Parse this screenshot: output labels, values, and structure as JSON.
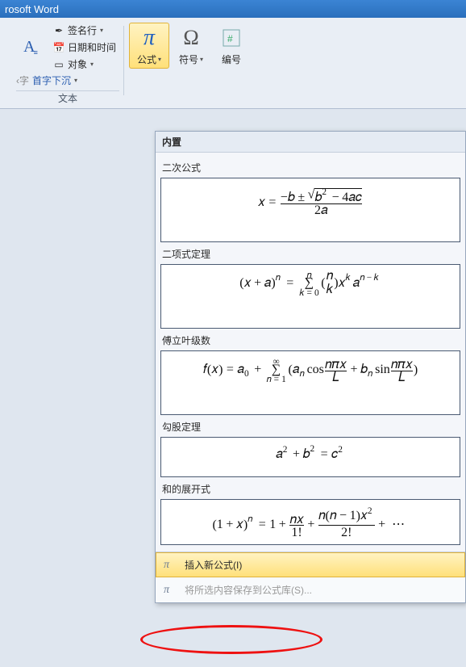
{
  "titlebar": {
    "title": "rosoft Word"
  },
  "ribbon": {
    "group_text": {
      "dropcap_label": "首字下沉",
      "signature_label": "签名行",
      "datetime_label": "日期和时间",
      "object_label": "对象",
      "label": "文本"
    },
    "group_symbols": {
      "equation_label": "公式",
      "symbol_label": "符号",
      "number_label": "编号"
    }
  },
  "gallery": {
    "header": "内置",
    "items": [
      {
        "title": "二次公式"
      },
      {
        "title": "二项式定理"
      },
      {
        "title": "傅立叶级数"
      },
      {
        "title": "勾股定理"
      },
      {
        "title": "和的展开式"
      }
    ],
    "footer": {
      "insert_new": "插入新公式(I)",
      "save_to_gallery": "将所选内容保存到公式库(S)..."
    }
  }
}
